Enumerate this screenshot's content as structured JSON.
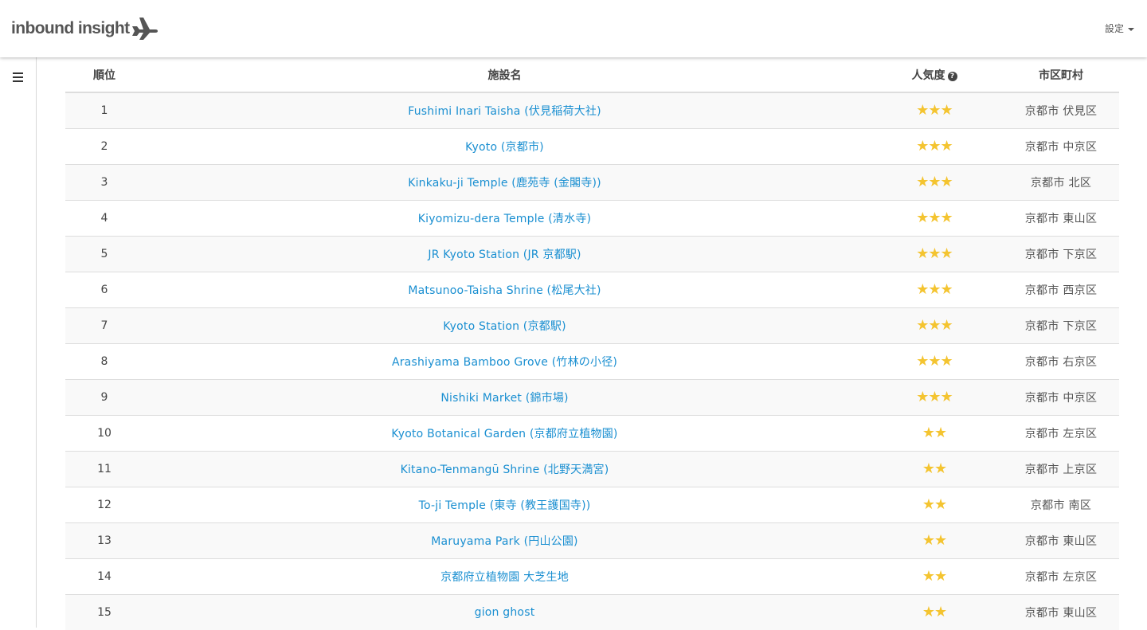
{
  "header": {
    "brand": "inbound insight",
    "settings_label": "設定"
  },
  "table": {
    "columns": {
      "rank": "順位",
      "name": "施設名",
      "popularity": "人気度",
      "city": "市区町村"
    },
    "rows": [
      {
        "rank": "1",
        "name": "Fushimi Inari Taisha (伏見稲荷大社)",
        "stars": "★★★",
        "rating": 3,
        "city": "京都市 伏見区"
      },
      {
        "rank": "2",
        "name": "Kyoto (京都市)",
        "stars": "★★★",
        "rating": 3,
        "city": "京都市 中京区"
      },
      {
        "rank": "3",
        "name": "Kinkaku-ji Temple (鹿苑寺 (金閣寺))",
        "stars": "★★★",
        "rating": 3,
        "city": "京都市 北区"
      },
      {
        "rank": "4",
        "name": "Kiyomizu-dera Temple (清水寺)",
        "stars": "★★★",
        "rating": 3,
        "city": "京都市 東山区"
      },
      {
        "rank": "5",
        "name": "JR Kyoto Station (JR 京都駅)",
        "stars": "★★★",
        "rating": 3,
        "city": "京都市 下京区"
      },
      {
        "rank": "6",
        "name": "Matsunoo-Taisha Shrine (松尾大社)",
        "stars": "★★★",
        "rating": 3,
        "city": "京都市 西京区"
      },
      {
        "rank": "7",
        "name": "Kyoto Station (京都駅)",
        "stars": "★★★",
        "rating": 3,
        "city": "京都市 下京区"
      },
      {
        "rank": "8",
        "name": "Arashiyama Bamboo Grove (竹林の小径)",
        "stars": "★★★",
        "rating": 3,
        "city": "京都市 右京区"
      },
      {
        "rank": "9",
        "name": "Nishiki Market (錦市場)",
        "stars": "★★★",
        "rating": 3,
        "city": "京都市 中京区"
      },
      {
        "rank": "10",
        "name": "Kyoto Botanical Garden (京都府立植物園)",
        "stars": "★★",
        "rating": 2,
        "city": "京都市 左京区"
      },
      {
        "rank": "11",
        "name": "Kitano-Tenmangū Shrine (北野天満宮)",
        "stars": "★★",
        "rating": 2,
        "city": "京都市 上京区"
      },
      {
        "rank": "12",
        "name": "To-ji Temple (東寺 (教王護国寺))",
        "stars": "★★",
        "rating": 2,
        "city": "京都市 南区"
      },
      {
        "rank": "13",
        "name": "Maruyama Park (円山公園)",
        "stars": "★★",
        "rating": 2,
        "city": "京都市 東山区"
      },
      {
        "rank": "14",
        "name": "京都府立植物園 大芝生地",
        "stars": "★★",
        "rating": 2,
        "city": "京都市 左京区"
      },
      {
        "rank": "15",
        "name": "gion ghost",
        "stars": "★★",
        "rating": 2,
        "city": "京都市 東山区"
      }
    ]
  },
  "colors": {
    "link": "#1a8fd1",
    "star": "#f4c430",
    "stripe": "#f9f9f9"
  },
  "icons": {
    "logo": "airplane-icon",
    "help": "question-circle-icon",
    "menu": "hamburger-menu-icon",
    "dropdown": "caret-down-icon",
    "rating": "star-icon"
  }
}
